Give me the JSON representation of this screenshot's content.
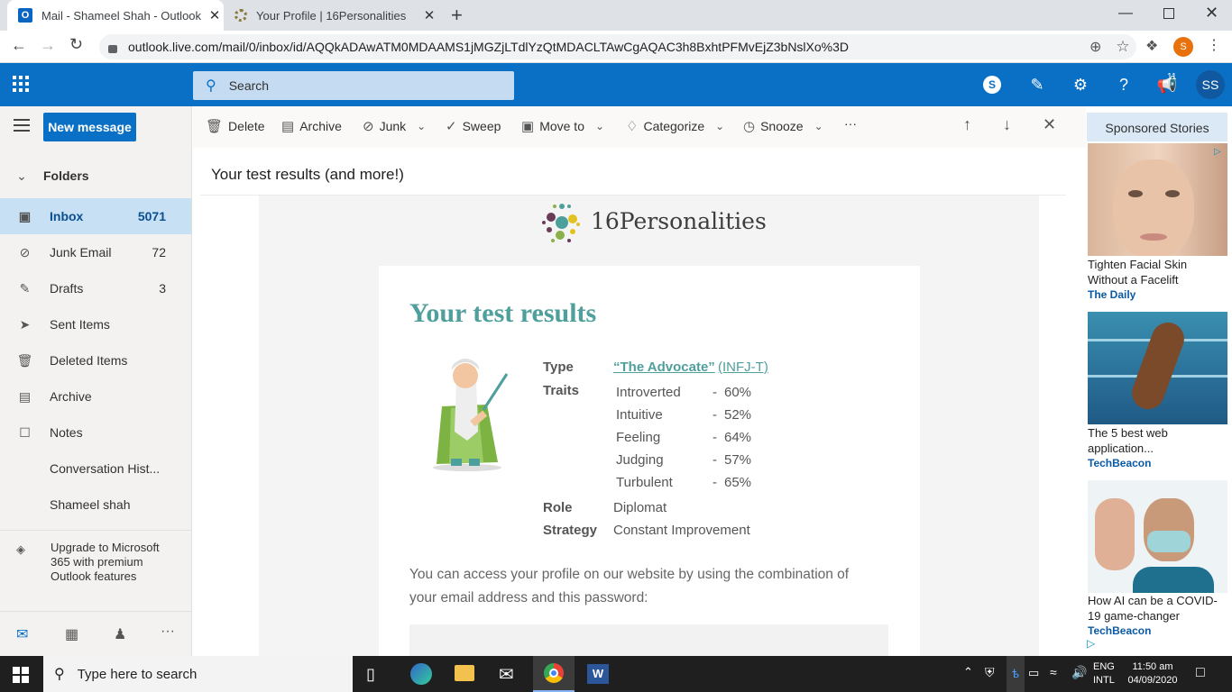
{
  "browser": {
    "tabs": [
      {
        "title": "Mail - Shameel Shah - Outlook",
        "close": "✕"
      },
      {
        "title": "Your Profile | 16Personalities",
        "close": "✕"
      }
    ],
    "new_tab": "+",
    "url": "outlook.live.com/mail/0/inbox/id/AQQkADAwATM0MDAAMS1jMGZjLTdlYzQtMDACLTAwCgAQAC3h8BxhtPFMvEjZ3bNslXo%3D",
    "avatar_letter": "S"
  },
  "owa": {
    "search_placeholder": "Search",
    "notification_count": "11",
    "user_initials": "SS",
    "new_message": "New message",
    "folders_header": "Folders",
    "folders": [
      {
        "label": "Inbox",
        "count": "5071",
        "icon": "inbox-icon"
      },
      {
        "label": "Junk Email",
        "count": "72",
        "icon": "junk-icon"
      },
      {
        "label": "Drafts",
        "count": "3",
        "icon": "pencil-icon"
      },
      {
        "label": "Sent Items",
        "count": "",
        "icon": "send-icon"
      },
      {
        "label": "Deleted Items",
        "count": "",
        "icon": "trash-icon"
      },
      {
        "label": "Archive",
        "count": "",
        "icon": "archive-icon"
      },
      {
        "label": "Notes",
        "count": "",
        "icon": "note-icon"
      },
      {
        "label": "Conversation Hist...",
        "count": "",
        "icon": ""
      },
      {
        "label": "Shameel shah",
        "count": "",
        "icon": ""
      }
    ],
    "upgrade_text": "Upgrade to Microsoft 365 with premium Outlook features",
    "toolbar": {
      "delete": "Delete",
      "archive": "Archive",
      "junk": "Junk",
      "sweep": "Sweep",
      "move_to": "Move to",
      "categorize": "Categorize",
      "snooze": "Snooze",
      "more": "···"
    },
    "subject": "Your test results (and more!)"
  },
  "email": {
    "brand": "16Personalities",
    "heading": "Your test results",
    "type_label": "Type",
    "type_value": "“The Advocate”",
    "type_code": "(INFJ-T)",
    "traits_label": "Traits",
    "traits": [
      {
        "name": "Introverted",
        "value": "60%"
      },
      {
        "name": "Intuitive",
        "value": "52%"
      },
      {
        "name": "Feeling",
        "value": "64%"
      },
      {
        "name": "Judging",
        "value": "57%"
      },
      {
        "name": "Turbulent",
        "value": "65%"
      }
    ],
    "dash": "-",
    "role_label": "Role",
    "role_value": "Diplomat",
    "strategy_label": "Strategy",
    "strategy_value": "Constant Improvement",
    "access_text_1": "You can access your profile on our website by using the combination of",
    "access_text_2": "your email address and this password:",
    "accent_color": "#4f9f9c"
  },
  "ads": {
    "header": "Sponsored Stories",
    "items": [
      {
        "title_1": "Tighten Facial Skin",
        "title_2": "Without a Facelift",
        "source": "The Daily"
      },
      {
        "title_1": "The 5 best web",
        "title_2": "application...",
        "source": "TechBeacon"
      },
      {
        "title_1": "How AI can be a COVID-",
        "title_2": "19 game-changer",
        "source": "TechBeacon"
      }
    ]
  },
  "taskbar": {
    "search_placeholder": "Type here to search",
    "lang_1": "ENG",
    "lang_2": "INTL",
    "time": "11:50 am",
    "date": "04/09/2020"
  }
}
